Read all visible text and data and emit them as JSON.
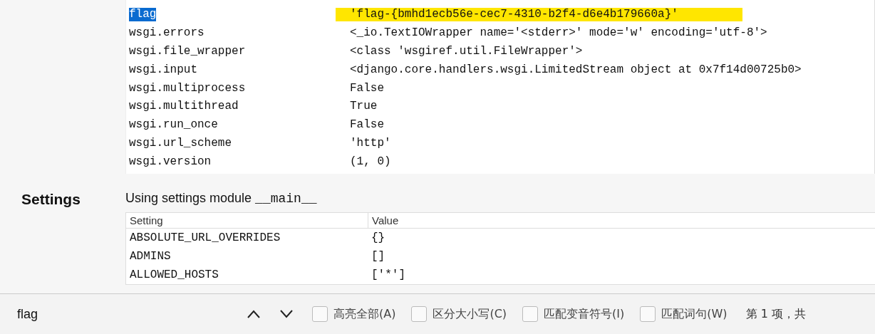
{
  "request_meta": {
    "rows": [
      {
        "key": "flag",
        "value": "'flag-{bmhd1ecb56e-cec7-4310-b2f4-d6e4b179660a}'",
        "key_selected": true,
        "value_highlighted": true
      },
      {
        "key": "wsgi.errors",
        "value": "<_io.TextIOWrapper name='<stderr>' mode='w' encoding='utf-8'>",
        "key_selected": false,
        "value_highlighted": false
      },
      {
        "key": "wsgi.file_wrapper",
        "value": "<class 'wsgiref.util.FileWrapper'>",
        "key_selected": false,
        "value_highlighted": false
      },
      {
        "key": "wsgi.input",
        "value": "<django.core.handlers.wsgi.LimitedStream object at 0x7f14d00725b0>",
        "key_selected": false,
        "value_highlighted": false
      },
      {
        "key": "wsgi.multiprocess",
        "value": "False",
        "key_selected": false,
        "value_highlighted": false
      },
      {
        "key": "wsgi.multithread",
        "value": "True",
        "key_selected": false,
        "value_highlighted": false
      },
      {
        "key": "wsgi.run_once",
        "value": "False",
        "key_selected": false,
        "value_highlighted": false
      },
      {
        "key": "wsgi.url_scheme",
        "value": "'http'",
        "key_selected": false,
        "value_highlighted": false
      },
      {
        "key": "wsgi.version",
        "value": "(1, 0)",
        "key_selected": false,
        "value_highlighted": false
      }
    ]
  },
  "settings": {
    "heading": "Settings",
    "intro": "Using settings module",
    "module": "__main__",
    "columns": [
      "Setting",
      "Value"
    ],
    "rows": [
      {
        "setting": "ABSOLUTE_URL_OVERRIDES",
        "value": "{}"
      },
      {
        "setting": "ADMINS",
        "value": "[]"
      },
      {
        "setting": "ALLOWED_HOSTS",
        "value": "['*']"
      }
    ]
  },
  "find_bar": {
    "query": "flag",
    "options": [
      {
        "label": "高亮全部(A)",
        "checked": false
      },
      {
        "label": "区分大小写(C)",
        "checked": false
      },
      {
        "label": "匹配变音符号(I)",
        "checked": false
      },
      {
        "label": "匹配词句(W)",
        "checked": false
      }
    ],
    "status": "第 1 项，共"
  }
}
